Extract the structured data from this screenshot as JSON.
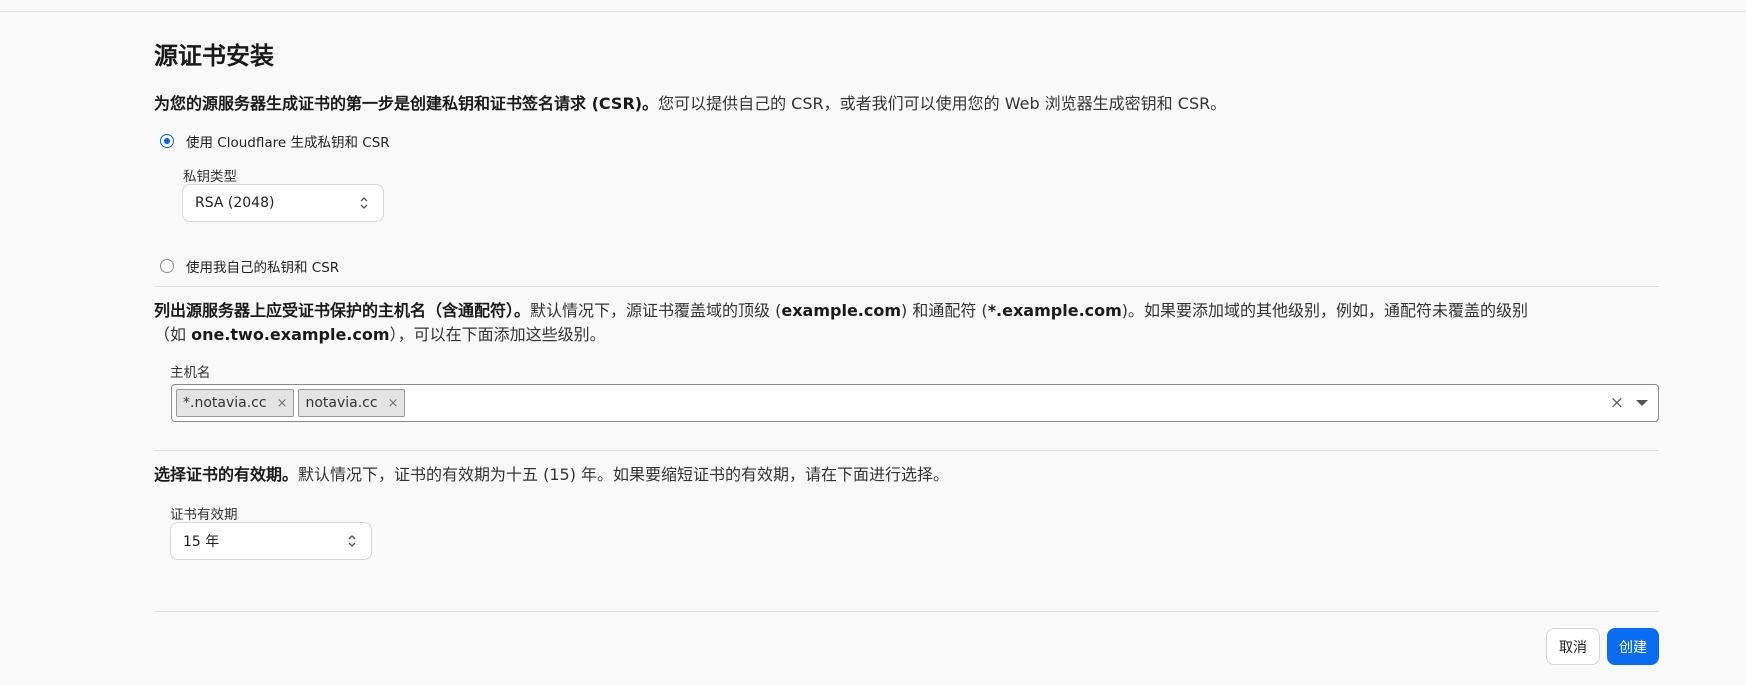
{
  "page": {
    "title": "源证书安装"
  },
  "csr_section": {
    "intro_bold": "为您的源服务器生成证书的第一步是创建私钥和证书签名请求 (CSR)。",
    "intro_rest": "您可以提供自己的 CSR，或者我们可以使用您的 Web 浏览器生成密钥和 CSR。",
    "option_cloudflare": "使用 Cloudflare 生成私钥和 CSR",
    "option_cloudflare_selected": true,
    "key_type_label": "私钥类型",
    "key_type_value": "RSA (2048)",
    "option_own": "使用我自己的私钥和 CSR",
    "option_own_selected": false
  },
  "hostname_section": {
    "intro_bold": "列出源服务器上应受证书保护的主机名（含通配符）。",
    "intro_part1": "默认情况下，源证书覆盖域的顶级 (",
    "example_apex": "example.com",
    "intro_part2": ") 和通配符 (",
    "example_wildcard": "*.example.com",
    "intro_part3": ")。如果要添加域的其他级别，例如，通配符未覆盖的级别（如 ",
    "example_sub": "one.two.example.com",
    "intro_part4": "），可以在下面添加这些级别。",
    "field_label": "主机名",
    "hostnames": [
      "*.notavia.cc",
      "notavia.cc"
    ],
    "remove_glyph": "×",
    "clear_glyph": "×"
  },
  "validity_section": {
    "intro_bold": "选择证书的有效期。",
    "intro_rest": "默认情况下，证书的有效期为十五 (15) 年。如果要缩短证书的有效期，请在下面进行选择。",
    "field_label": "证书有效期",
    "value": "15 年"
  },
  "actions": {
    "cancel_label": "取消",
    "create_label": "创建"
  },
  "colors": {
    "primary": "#0a6cf1",
    "radio_selected": "#0a5fe0"
  }
}
